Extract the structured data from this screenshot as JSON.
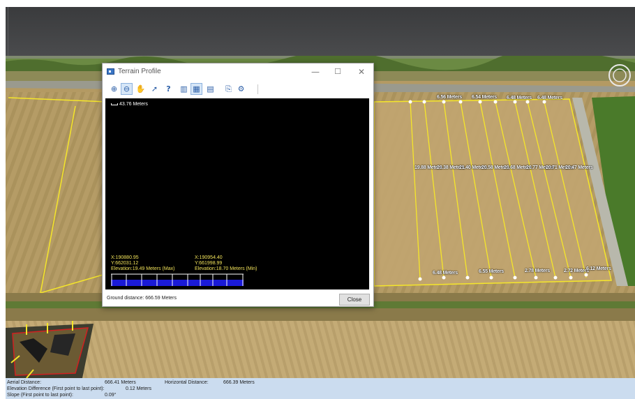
{
  "window": {
    "title": "Terrain Profile",
    "scale_text": "43.76 Meters",
    "point_left": {
      "x": "X:190880.95",
      "y": "Y:662031.12",
      "elevation": "Elevation:19.49 Meters (Max)"
    },
    "point_right": {
      "x": "X:190954.40",
      "y": "Y:661998.99",
      "elevation": "Elevation:18.70 Meters (Min)"
    },
    "ground_distance": "Ground distance: 666.59 Meters",
    "close_label": "Close",
    "controls": {
      "minimize": "—",
      "maximize": "☐",
      "close": "✕"
    }
  },
  "toolbar": [
    {
      "name": "zoom-in-icon",
      "glyph": "⊕"
    },
    {
      "name": "zoom-out-icon",
      "glyph": "⊖"
    },
    {
      "name": "pan-hand-icon",
      "glyph": "✋"
    },
    {
      "name": "arrow-icon",
      "glyph": "➚"
    },
    {
      "name": "help-icon",
      "glyph": "?"
    },
    {
      "name": "profile-view-1-icon",
      "glyph": "▥"
    },
    {
      "name": "profile-view-2-icon",
      "glyph": "▦"
    },
    {
      "name": "profile-view-3-icon",
      "glyph": "▤"
    },
    {
      "name": "export-icon",
      "glyph": "⎘"
    },
    {
      "name": "settings-icon",
      "glyph": "⚙"
    }
  ],
  "scene_labels": {
    "top": [
      "6.56 Meters",
      "6.54 Meters",
      "6.48 Meters",
      "6.48 Meters"
    ],
    "middle": [
      "19.88 Meters",
      "20.38 Meters",
      "21.40 Meters",
      "20.58 Meters",
      "20.68 Meters",
      "20.77 Meters",
      "20.71 Meters",
      "20.47 Meters"
    ],
    "bottom": [
      "6.48 Meters",
      "6.55 Meters",
      "2.78 Meters",
      "2.72 Meters",
      "6.12 Meters"
    ]
  },
  "info": {
    "aerial_label": "Aerial Distance:",
    "aerial_value": "666.41 Meters",
    "horizontal_label": "Horizontal Distance:",
    "horizontal_value": "666.39 Meters",
    "elev_diff_label": "Elevation Difference (First point to last point):",
    "elev_diff_value": "0.12 Meters",
    "slope_label": "Slope (First point to last point):",
    "slope_value": "0.09°"
  },
  "colors": {
    "accent": "#f5e62a",
    "field": "#b49a63",
    "profile_bar": "#1a1ad8"
  }
}
